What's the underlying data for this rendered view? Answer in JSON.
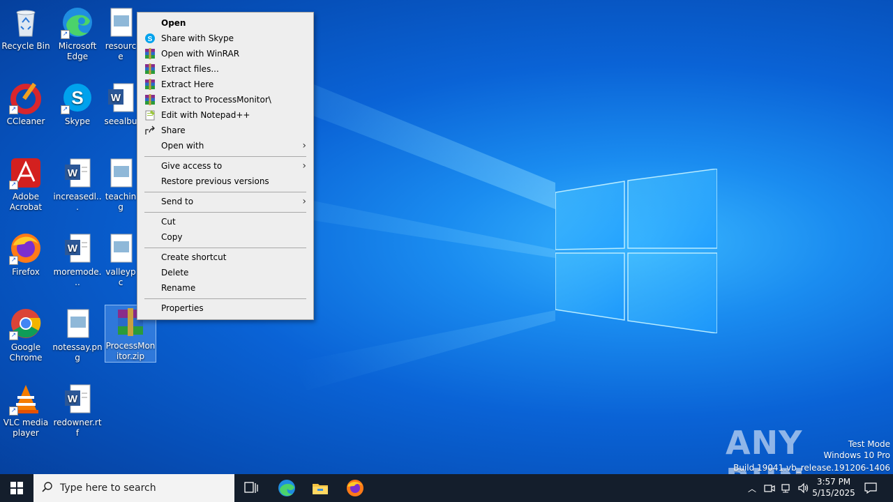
{
  "desktop": {
    "icons": [
      {
        "name": "recycle-bin",
        "label": "Recycle Bin"
      },
      {
        "name": "microsoft-edge",
        "label": "Microsoft Edge"
      },
      {
        "name": "resource",
        "label": "resource"
      },
      {
        "name": "ccleaner",
        "label": "CCleaner"
      },
      {
        "name": "skype",
        "label": "Skype"
      },
      {
        "name": "seealbu",
        "label": "seealbu"
      },
      {
        "name": "adobe-acrobat",
        "label": "Adobe Acrobat"
      },
      {
        "name": "increasedl",
        "label": "increasedl..."
      },
      {
        "name": "teaching",
        "label": "teaching"
      },
      {
        "name": "firefox",
        "label": "Firefox"
      },
      {
        "name": "moremode",
        "label": "moremode..."
      },
      {
        "name": "valleypc",
        "label": "valleypc"
      },
      {
        "name": "google-chrome",
        "label": "Google Chrome"
      },
      {
        "name": "notessay",
        "label": "notessay.png"
      },
      {
        "name": "processmonitor-zip",
        "label": "ProcessMonitor.zip"
      },
      {
        "name": "vlc",
        "label": "VLC media player"
      },
      {
        "name": "redowner",
        "label": "redowner.rtf"
      }
    ]
  },
  "context_menu": {
    "items": [
      {
        "label": "Open",
        "icon": ""
      },
      {
        "label": "Share with Skype",
        "icon": "skype-icon"
      },
      {
        "label": "Open with WinRAR",
        "icon": "winrar-icon"
      },
      {
        "label": "Extract files...",
        "icon": "winrar-icon"
      },
      {
        "label": "Extract Here",
        "icon": "winrar-icon"
      },
      {
        "label": "Extract to ProcessMonitor\\",
        "icon": "winrar-icon"
      },
      {
        "label": "Edit with Notepad++",
        "icon": "notepadpp-icon"
      },
      {
        "label": "Share",
        "icon": "share-icon"
      },
      {
        "label": "Open with",
        "icon": ""
      },
      {
        "label": "Give access to",
        "icon": ""
      },
      {
        "label": "Restore previous versions",
        "icon": ""
      },
      {
        "label": "Send to",
        "icon": ""
      },
      {
        "label": "Cut",
        "icon": ""
      },
      {
        "label": "Copy",
        "icon": ""
      },
      {
        "label": "Create shortcut",
        "icon": ""
      },
      {
        "label": "Delete",
        "icon": ""
      },
      {
        "label": "Rename",
        "icon": ""
      },
      {
        "label": "Properties",
        "icon": ""
      }
    ]
  },
  "watermark": {
    "brand": "ANY RUN",
    "line1": "Test Mode",
    "line2": "Windows 10 Pro",
    "line3": "Build 19041.vb_release.191206-1406"
  },
  "taskbar": {
    "search_placeholder": "Type here to search",
    "time": "3:57 PM",
    "date": "5/15/2025"
  },
  "colors": {
    "taskbar_bg": "#141e2c",
    "menu_bg": "#eeeeee",
    "desktop_accent": "#0a63d6"
  }
}
